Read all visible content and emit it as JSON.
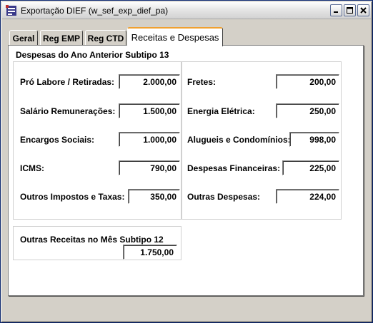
{
  "window": {
    "title": "Exportação DIEF (w_sef_exp_dief_pa)"
  },
  "tabs": [
    {
      "label": "Geral"
    },
    {
      "label": "Reg EMP"
    },
    {
      "label": "Reg CTD"
    },
    {
      "label": "Receitas e Despesas",
      "active": true
    }
  ],
  "despesas": {
    "title": "Despesas do Ano Anterior Subtipo 13",
    "left": [
      {
        "label": "Pró Labore / Retiradas:",
        "value": "2.000,00"
      },
      {
        "label": "Salário Remunerações:",
        "value": "1.500,00"
      },
      {
        "label": "Encargos Sociais:",
        "value": "1.000,00"
      },
      {
        "label": "ICMS:",
        "value": "790,00"
      },
      {
        "label": "Outros Impostos e Taxas:",
        "value": "350,00"
      }
    ],
    "right": [
      {
        "label": "Fretes:",
        "value": "200,00"
      },
      {
        "label": "Energia Elétrica:",
        "value": "250,00"
      },
      {
        "label": "Alugueis e Condomínios:",
        "value": "998,00"
      },
      {
        "label": "Despesas Financeiras:",
        "value": "225,00"
      },
      {
        "label": "Outras Despesas:",
        "value": "224,00"
      }
    ]
  },
  "receitas": {
    "title": "Outras Receitas no Mês Subtipo 12",
    "value": "1.750,00"
  }
}
